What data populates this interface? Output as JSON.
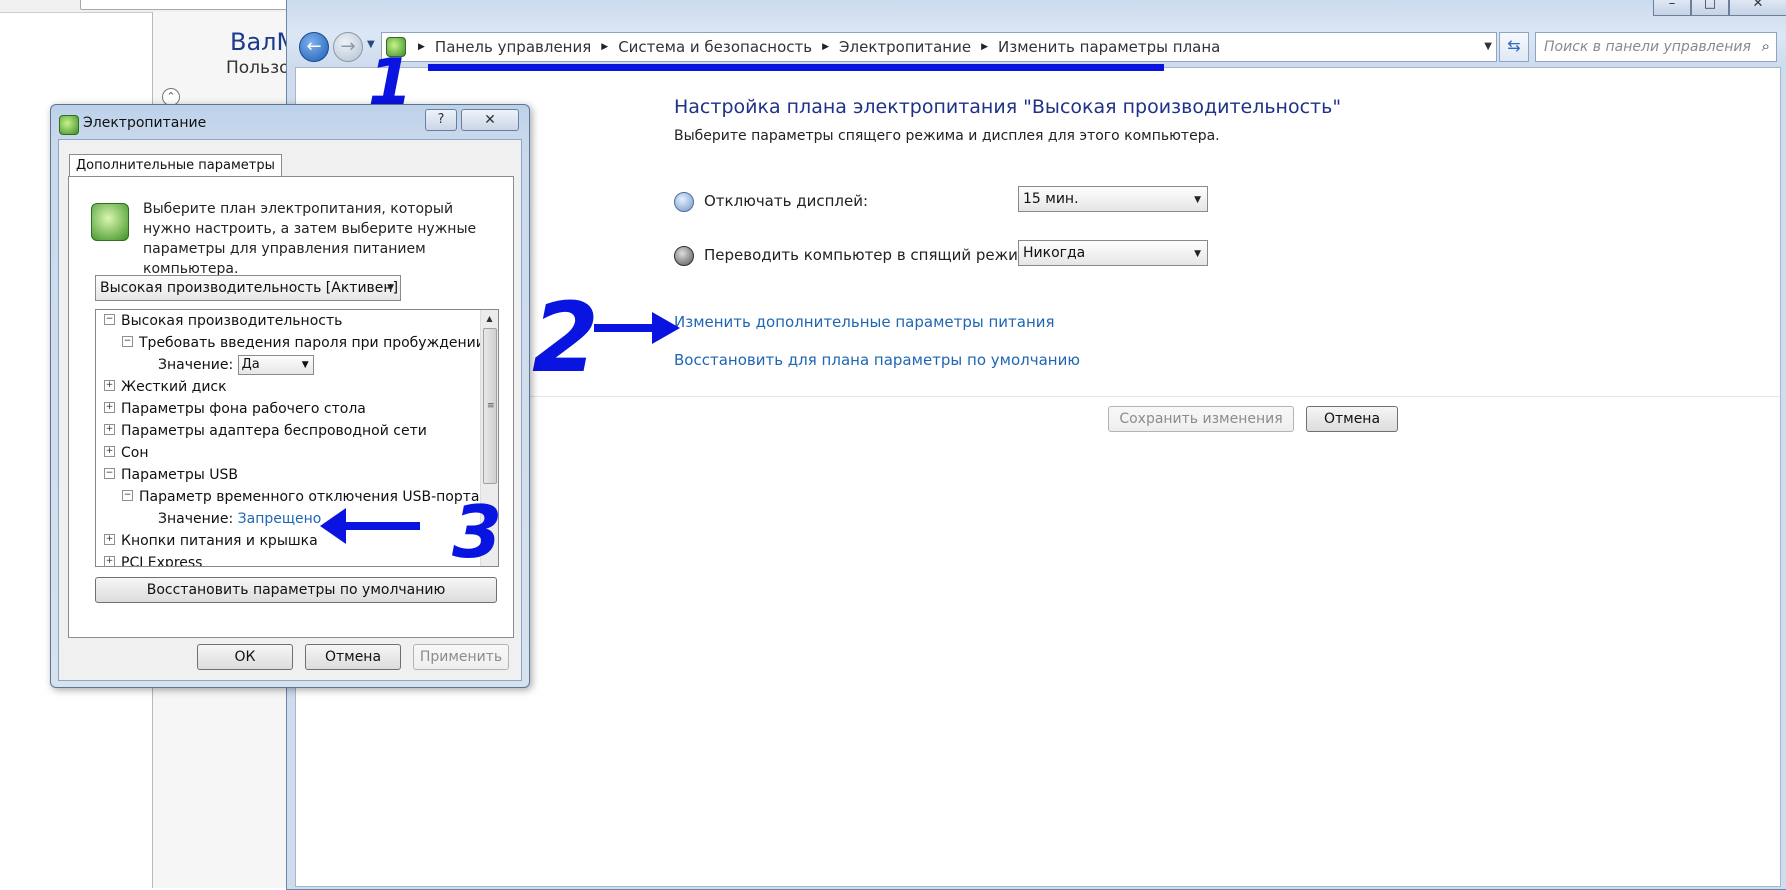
{
  "background": {
    "user_name": "ВалМ",
    "user_sub": "Пользо"
  },
  "control_panel": {
    "address": {
      "crumbs": [
        "Панель управления",
        "Система и безопасность",
        "Электропитание",
        "Изменить параметры плана"
      ]
    },
    "search": {
      "placeholder": "Поиск в панели управления"
    },
    "plan_title": "Настройка плана электропитания \"Высокая производительность\"",
    "plan_subtitle": "Выберите параметры спящего режима и дисплея для этого компьютера.",
    "display_off": {
      "label": "Отключать дисплей:",
      "value": "15 мин."
    },
    "sleep": {
      "label": "Переводить компьютер в спящий режим:",
      "value": "Никогда"
    },
    "link_advanced": "Изменить дополнительные параметры питания",
    "link_restore": "Восстановить для плана параметры по умолчанию",
    "save_button": "Сохранить изменения",
    "cancel_button": "Отмена"
  },
  "annotations": {
    "one": "1",
    "two": "2",
    "three": "3"
  },
  "dialog": {
    "title": "Электропитание",
    "help": "?",
    "close": "✕",
    "tab": "Дополнительные параметры",
    "intro": "Выберите план электропитания, который нужно настроить, а затем выберите нужные параметры для управления питанием компьютера.",
    "plan_select": "Высокая производительность [Активен]",
    "tree": [
      {
        "label": "Высокая производительность",
        "sign": "−",
        "level": 0
      },
      {
        "label": "Требовать введения пароля при пробуждении",
        "sign": "−",
        "level": 1
      },
      {
        "label": "Значение:",
        "value": "Да",
        "kind": "select",
        "level": 2
      },
      {
        "label": "Жесткий диск",
        "sign": "+",
        "level": 0
      },
      {
        "label": "Параметры фона рабочего стола",
        "sign": "+",
        "level": 0
      },
      {
        "label": "Параметры адаптера беспроводной сети",
        "sign": "+",
        "level": 0
      },
      {
        "label": "Сон",
        "sign": "+",
        "level": 0
      },
      {
        "label": "Параметры USB",
        "sign": "−",
        "level": 0
      },
      {
        "label": "Параметр временного отключения USB-порта",
        "sign": "−",
        "level": 1
      },
      {
        "label": "Значение:",
        "value": "Запрещено",
        "kind": "link",
        "level": 2
      },
      {
        "label": "Кнопки питания и крышка",
        "sign": "+",
        "level": 0
      },
      {
        "label": "PCI Express",
        "sign": "+",
        "level": 0
      }
    ],
    "restore_defaults": "Восстановить параметры по умолчанию",
    "ok": "ОК",
    "cancel": "Отмена",
    "apply": "Применить"
  }
}
